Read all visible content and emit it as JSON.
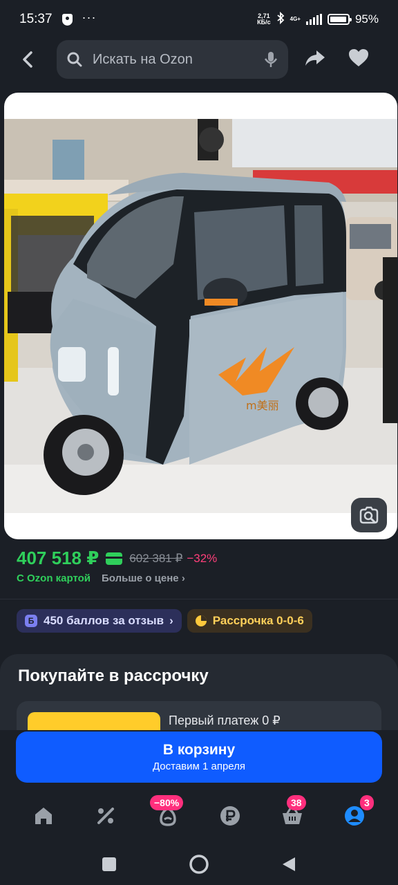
{
  "status_bar": {
    "time": "15:37",
    "net_speed_value": "2,71",
    "net_speed_unit": "КБ/с",
    "network_type": "4G+",
    "battery_percent": "95%"
  },
  "search": {
    "placeholder": "Искать на Ozon"
  },
  "price": {
    "current": "407 518 ₽",
    "old": "602 381 ₽",
    "discount": "−32%",
    "ozon_card_label": "С Ozon картой",
    "more_price_label": "Больше о цене"
  },
  "chips": {
    "points_badge": "Б",
    "points_label": "450 баллов за отзыв",
    "installment_label": "Рассрочка 0-0-6"
  },
  "sheet": {
    "title": "Покупайте в рассрочку",
    "first_payment": "Первый платеж 0 ₽"
  },
  "cart": {
    "label": "В корзину",
    "delivery": "Доставим 1 апреля"
  },
  "bottom_nav": {
    "items": [
      {
        "name": "home",
        "badge": ""
      },
      {
        "name": "discounts",
        "badge": ""
      },
      {
        "name": "fresh",
        "badge": "−80%"
      },
      {
        "name": "finance",
        "badge": ""
      },
      {
        "name": "cart",
        "badge": "38"
      },
      {
        "name": "profile",
        "badge": "3"
      }
    ]
  },
  "colors": {
    "background": "#1b1f26",
    "price_green": "#2fcf5b",
    "discount_pink": "#ff3f7a",
    "primary_blue": "#0f5cff",
    "badge_pink": "#ff2f7d"
  }
}
